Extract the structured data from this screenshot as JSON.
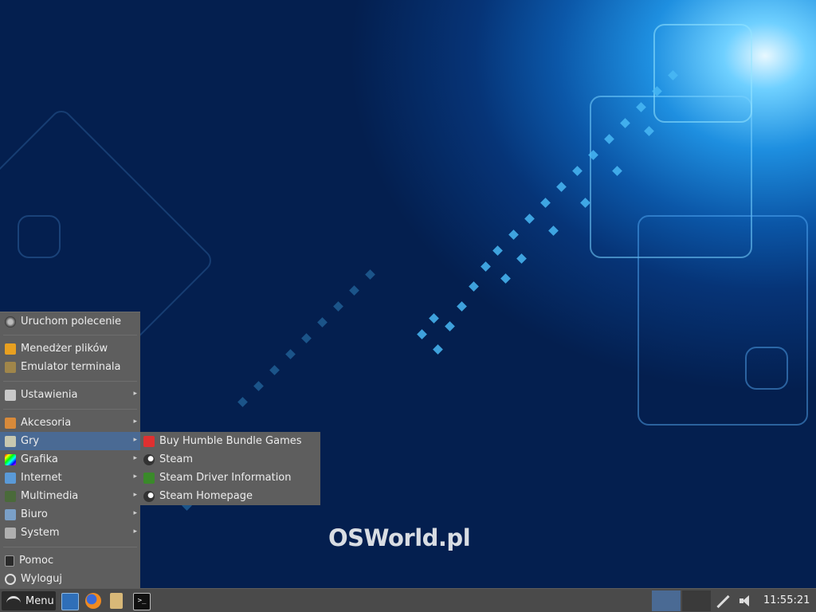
{
  "desktop": {
    "brand_text": "OSWorld.pl"
  },
  "menu": {
    "items": [
      {
        "label": "Uruchom polecenie",
        "icon": "run-icon",
        "submenu": false
      },
      {
        "label": "Menedżer plików",
        "icon": "file-manager-icon",
        "submenu": false
      },
      {
        "label": "Emulator terminala",
        "icon": "terminal-icon",
        "submenu": false
      },
      {
        "label": "Ustawienia",
        "icon": "settings-icon",
        "submenu": true
      },
      {
        "label": "Akcesoria",
        "icon": "accessories-icon",
        "submenu": true
      },
      {
        "label": "Gry",
        "icon": "games-icon",
        "submenu": true,
        "active": true
      },
      {
        "label": "Grafika",
        "icon": "graphics-icon",
        "submenu": true
      },
      {
        "label": "Internet",
        "icon": "internet-icon",
        "submenu": true
      },
      {
        "label": "Multimedia",
        "icon": "multimedia-icon",
        "submenu": true
      },
      {
        "label": "Biuro",
        "icon": "office-icon",
        "submenu": true
      },
      {
        "label": "System",
        "icon": "system-icon",
        "submenu": true
      },
      {
        "label": "Pomoc",
        "icon": "help-icon",
        "submenu": false
      },
      {
        "label": "Wyloguj",
        "icon": "logout-icon",
        "submenu": false
      }
    ],
    "arrow": "▸"
  },
  "submenu": {
    "items": [
      {
        "label": "Buy Humble Bundle Games",
        "icon": "humble-bundle-icon"
      },
      {
        "label": "Steam",
        "icon": "steam-icon"
      },
      {
        "label": "Steam Driver Information",
        "icon": "driver-info-icon"
      },
      {
        "label": "Steam Homepage",
        "icon": "steam-icon"
      }
    ]
  },
  "taskbar": {
    "menu_label": "Menu",
    "launchers": [
      "file-manager-icon",
      "firefox-icon",
      "folder-icon",
      "terminal-icon"
    ],
    "tray": [
      "network-icon",
      "volume-icon"
    ],
    "clock": "11:55:21"
  },
  "colors": {
    "menu_bg": "#5e5e5e",
    "active_bg": "#4a6a94",
    "taskbar_bg": "#4a4a4a"
  }
}
